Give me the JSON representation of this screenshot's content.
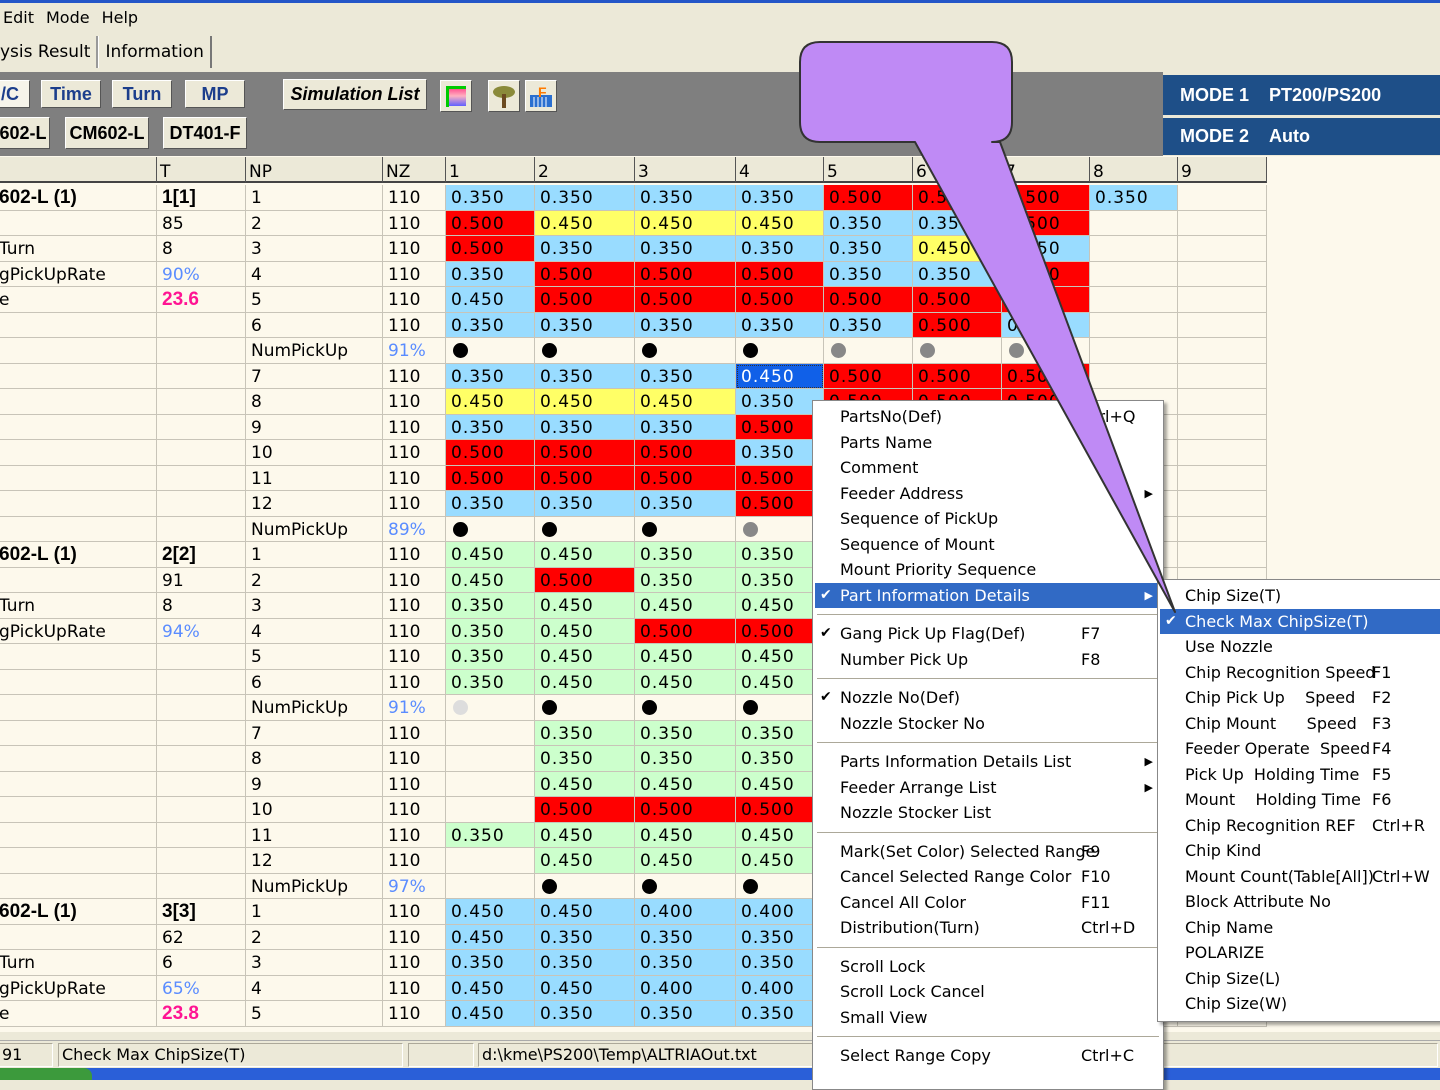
{
  "menubar": [
    "Edit",
    "Mode",
    "Help"
  ],
  "tabs": [
    "ysis Result",
    "Information"
  ],
  "toolbar": {
    "row1": [
      "/C",
      "Time",
      "Turn",
      "MP"
    ],
    "simulation_list": "Simulation List",
    "row2": [
      "602-L",
      "CM602-L",
      "DT401-F"
    ],
    "icons": [
      "color-palette-icon",
      "tree-icon",
      "chart-f-icon"
    ]
  },
  "mode1": {
    "label": "MODE 1",
    "value": "PT200/PS200"
  },
  "mode2": {
    "label": "MODE 2",
    "value": "Auto"
  },
  "colors": {
    "b": "#99dcff",
    "r": "#ff0000",
    "y": "#ffff66",
    "g": "#ccffcc",
    "s": "#1060e8",
    "k": "#000000",
    "gr": "#888888",
    "lg": "#dddddd",
    "pct": "#5a8cff",
    "mag": "#ff1493"
  },
  "grid": {
    "headers": [
      "",
      "T",
      "NP",
      "NZ",
      "1",
      "2",
      "3",
      "4",
      "5",
      "6",
      "7",
      "8",
      "9"
    ],
    "rows": [
      {
        "c0": "602-L (1)",
        "t": "1[1]",
        "ts": "bold",
        "np": "1",
        "nz": "110",
        "cells": [
          "b:0.350",
          "b:0.350",
          "b:0.350",
          "b:0.350",
          "r:0.500",
          "r:0.500",
          "r:0.500",
          "b:0.350"
        ]
      },
      {
        "c0": "",
        "t": "85",
        "np": "2",
        "nz": "110",
        "cells": [
          "r:0.500",
          "y:0.450",
          "y:0.450",
          "y:0.450",
          "b:0.350",
          "b:0.350",
          "r:0.500"
        ]
      },
      {
        "c0": "Turn",
        "t": "8",
        "np": "3",
        "nz": "110",
        "cells": [
          "r:0.500",
          "b:0.350",
          "b:0.350",
          "b:0.350",
          "b:0.350",
          "y:0.450",
          "b:0.350"
        ]
      },
      {
        "c0": "gPickUpRate",
        "t": "90%",
        "ts": "pct",
        "np": "4",
        "nz": "110",
        "cells": [
          "b:0.350",
          "r:0.500",
          "r:0.500",
          "r:0.500",
          "b:0.350",
          "b:0.350",
          "r:0.500"
        ]
      },
      {
        "c0": "e",
        "t": "23.6",
        "ts": "mag",
        "np": "5",
        "nz": "110",
        "cells": [
          "b:0.450",
          "r:0.500",
          "r:0.500",
          "r:0.500",
          "r:0.500",
          "r:0.500",
          "r:0.500"
        ]
      },
      {
        "c0": "",
        "t": "",
        "np": "6",
        "nz": "110",
        "cells": [
          "b:0.350",
          "b:0.350",
          "b:0.350",
          "b:0.350",
          "b:0.350",
          "r:0.500",
          "b:0.350"
        ]
      },
      {
        "c0": "",
        "t": "",
        "np": "NumPickUp",
        "nz": "91%",
        "nzs": "pct",
        "cells": [
          "dot:k",
          "dot:k",
          "dot:k",
          "dot:k",
          "dot:gr",
          "dot:gr",
          "dot:gr"
        ]
      },
      {
        "c0": "",
        "t": "",
        "np": "7",
        "nz": "110",
        "cells": [
          "b:0.350",
          "b:0.350",
          "b:0.350",
          "s:0.450",
          "r:0.500",
          "r:0.500",
          "r:0.500"
        ]
      },
      {
        "c0": "",
        "t": "",
        "np": "8",
        "nz": "110",
        "cells": [
          "y:0.450",
          "y:0.450",
          "y:0.450",
          "b:0.350",
          "r:0.500",
          "r:0.500",
          "r:0.500"
        ]
      },
      {
        "c0": "",
        "t": "",
        "np": "9",
        "nz": "110",
        "cells": [
          "b:0.350",
          "b:0.350",
          "b:0.350",
          "r:0.500"
        ]
      },
      {
        "c0": "",
        "t": "",
        "np": "10",
        "nz": "110",
        "cells": [
          "r:0.500",
          "r:0.500",
          "r:0.500",
          "b:0.350"
        ]
      },
      {
        "c0": "",
        "t": "",
        "np": "11",
        "nz": "110",
        "cells": [
          "r:0.500",
          "r:0.500",
          "r:0.500",
          "r:0.500"
        ]
      },
      {
        "c0": "",
        "t": "",
        "np": "12",
        "nz": "110",
        "cells": [
          "b:0.350",
          "b:0.350",
          "b:0.350",
          "r:0.500"
        ]
      },
      {
        "c0": "",
        "t": "",
        "np": "NumPickUp",
        "nz": "89%",
        "nzs": "pct",
        "cells": [
          "dot:k",
          "dot:k",
          "dot:k",
          "dot:gr"
        ]
      },
      {
        "c0": "602-L (1)",
        "t": "2[2]",
        "ts": "bold",
        "np": "1",
        "nz": "110",
        "cells": [
          "g:0.450",
          "g:0.450",
          "g:0.350",
          "g:0.350"
        ]
      },
      {
        "c0": "",
        "t": "91",
        "np": "2",
        "nz": "110",
        "cells": [
          "g:0.450",
          "r:0.500",
          "g:0.350",
          "g:0.350"
        ]
      },
      {
        "c0": "Turn",
        "t": "8",
        "np": "3",
        "nz": "110",
        "cells": [
          "g:0.350",
          "g:0.450",
          "g:0.450",
          "g:0.450"
        ]
      },
      {
        "c0": "gPickUpRate",
        "t": "94%",
        "ts": "pct",
        "np": "4",
        "nz": "110",
        "cells": [
          "g:0.350",
          "g:0.450",
          "r:0.500",
          "r:0.500"
        ]
      },
      {
        "c0": "",
        "t": "",
        "np": "5",
        "nz": "110",
        "cells": [
          "g:0.350",
          "g:0.450",
          "g:0.450",
          "g:0.450"
        ]
      },
      {
        "c0": "",
        "t": "",
        "np": "6",
        "nz": "110",
        "cells": [
          "g:0.350",
          "g:0.450",
          "g:0.450",
          "g:0.450"
        ]
      },
      {
        "c0": "",
        "t": "",
        "np": "NumPickUp",
        "nz": "91%",
        "nzs": "pct",
        "cells": [
          "dot:lg",
          "dot:k",
          "dot:k",
          "dot:k"
        ]
      },
      {
        "c0": "",
        "t": "",
        "np": "7",
        "nz": "110",
        "cells": [
          "",
          "g:0.350",
          "g:0.350",
          "g:0.350"
        ]
      },
      {
        "c0": "",
        "t": "",
        "np": "8",
        "nz": "110",
        "cells": [
          "",
          "g:0.350",
          "g:0.350",
          "g:0.350"
        ]
      },
      {
        "c0": "",
        "t": "",
        "np": "9",
        "nz": "110",
        "cells": [
          "",
          "g:0.450",
          "g:0.450",
          "g:0.450"
        ]
      },
      {
        "c0": "",
        "t": "",
        "np": "10",
        "nz": "110",
        "cells": [
          "",
          "r:0.500",
          "r:0.500",
          "r:0.500"
        ]
      },
      {
        "c0": "",
        "t": "",
        "np": "11",
        "nz": "110",
        "cells": [
          "g:0.350",
          "g:0.450",
          "g:0.450",
          "g:0.450"
        ]
      },
      {
        "c0": "",
        "t": "",
        "np": "12",
        "nz": "110",
        "cells": [
          "",
          "g:0.450",
          "g:0.450",
          "g:0.450"
        ]
      },
      {
        "c0": "",
        "t": "",
        "np": "NumPickUp",
        "nz": "97%",
        "nzs": "pct",
        "cells": [
          "",
          "dot:k",
          "dot:k",
          "dot:k"
        ]
      },
      {
        "c0": "602-L (1)",
        "t": "3[3]",
        "ts": "bold",
        "np": "1",
        "nz": "110",
        "cells": [
          "b:0.450",
          "b:0.450",
          "b:0.400",
          "b:0.400"
        ]
      },
      {
        "c0": "",
        "t": "62",
        "np": "2",
        "nz": "110",
        "cells": [
          "b:0.450",
          "b:0.350",
          "b:0.350",
          "b:0.350"
        ]
      },
      {
        "c0": "Turn",
        "t": "6",
        "np": "3",
        "nz": "110",
        "cells": [
          "b:0.350",
          "b:0.350",
          "b:0.350",
          "b:0.350"
        ]
      },
      {
        "c0": "gPickUpRate",
        "t": "65%",
        "ts": "pct",
        "np": "4",
        "nz": "110",
        "cells": [
          "b:0.450",
          "b:0.450",
          "b:0.400",
          "b:0.400"
        ]
      },
      {
        "c0": "e",
        "t": "23.8",
        "ts": "mag",
        "np": "5",
        "nz": "110",
        "cells": [
          "b:0.450",
          "b:0.350",
          "b:0.350",
          "b:0.350"
        ]
      }
    ]
  },
  "status": {
    "count": "91",
    "message": "Check Max ChipSize(T)",
    "blank": "",
    "path": "d:\\kme\\PS200\\Temp\\ALTRIAOut.txt"
  },
  "context_menu": [
    {
      "label": "PartsNo(Def)",
      "shortcut": "Ctrl+Q"
    },
    {
      "label": "Parts Name"
    },
    {
      "label": "Comment"
    },
    {
      "label": "Feeder Address",
      "submenu": true
    },
    {
      "label": "Sequence of PickUp"
    },
    {
      "label": "Sequence of Mount"
    },
    {
      "label": "Mount Priority Sequence"
    },
    {
      "label": "Part Information Details",
      "checked": true,
      "submenu": true,
      "highlight": true
    },
    {
      "sep": true
    },
    {
      "label": "Gang Pick Up Flag(Def)",
      "checked": true,
      "shortcut": "F7"
    },
    {
      "label": "Number Pick Up",
      "shortcut": "F8"
    },
    {
      "sep": true
    },
    {
      "label": "Nozzle No(Def)",
      "checked": true
    },
    {
      "label": "Nozzle Stocker No"
    },
    {
      "sep": true
    },
    {
      "label": "Parts Information Details List",
      "submenu": true
    },
    {
      "label": "Feeder Arrange List",
      "submenu": true
    },
    {
      "label": "Nozzle Stocker List"
    },
    {
      "sep": true
    },
    {
      "label": "Mark(Set Color) Selected Range",
      "shortcut": "F9"
    },
    {
      "label": "Cancel Selected Range Color",
      "shortcut": "F10"
    },
    {
      "label": "Cancel All Color",
      "shortcut": "F11"
    },
    {
      "label": "Distribution(Turn)",
      "shortcut": "Ctrl+D"
    },
    {
      "sep": true
    },
    {
      "label": "Scroll Lock"
    },
    {
      "label": "Scroll Lock Cancel"
    },
    {
      "label": "Small View"
    },
    {
      "sep": true
    },
    {
      "label": "Select Range Copy",
      "shortcut": "Ctrl+C"
    }
  ],
  "submenu": [
    {
      "label": "Chip Size(T)"
    },
    {
      "label": "Check Max ChipSize(T)",
      "checked": true,
      "highlight": true
    },
    {
      "label": "Use Nozzle"
    },
    {
      "label": "Chip Recognition Speed",
      "shortcut": "F1"
    },
    {
      "label": "Chip Pick Up    Speed",
      "shortcut": "F2"
    },
    {
      "label": "Chip Mount      Speed",
      "shortcut": "F3"
    },
    {
      "label": "Feeder Operate  Speed",
      "shortcut": "F4"
    },
    {
      "label": "Pick Up  Holding Time",
      "shortcut": "F5"
    },
    {
      "label": "Mount    Holding Time",
      "shortcut": "F6"
    },
    {
      "label": "Chip Recognition REF",
      "shortcut": "Ctrl+R"
    },
    {
      "label": "Chip Kind"
    },
    {
      "label": "Mount Count(Table[All])",
      "shortcut": "Ctrl+W"
    },
    {
      "label": "Block Attribute No"
    },
    {
      "label": "Chip Name"
    },
    {
      "label": "POLARIZE"
    },
    {
      "label": "Chip Size(L)"
    },
    {
      "label": "Chip Size(W)"
    }
  ]
}
